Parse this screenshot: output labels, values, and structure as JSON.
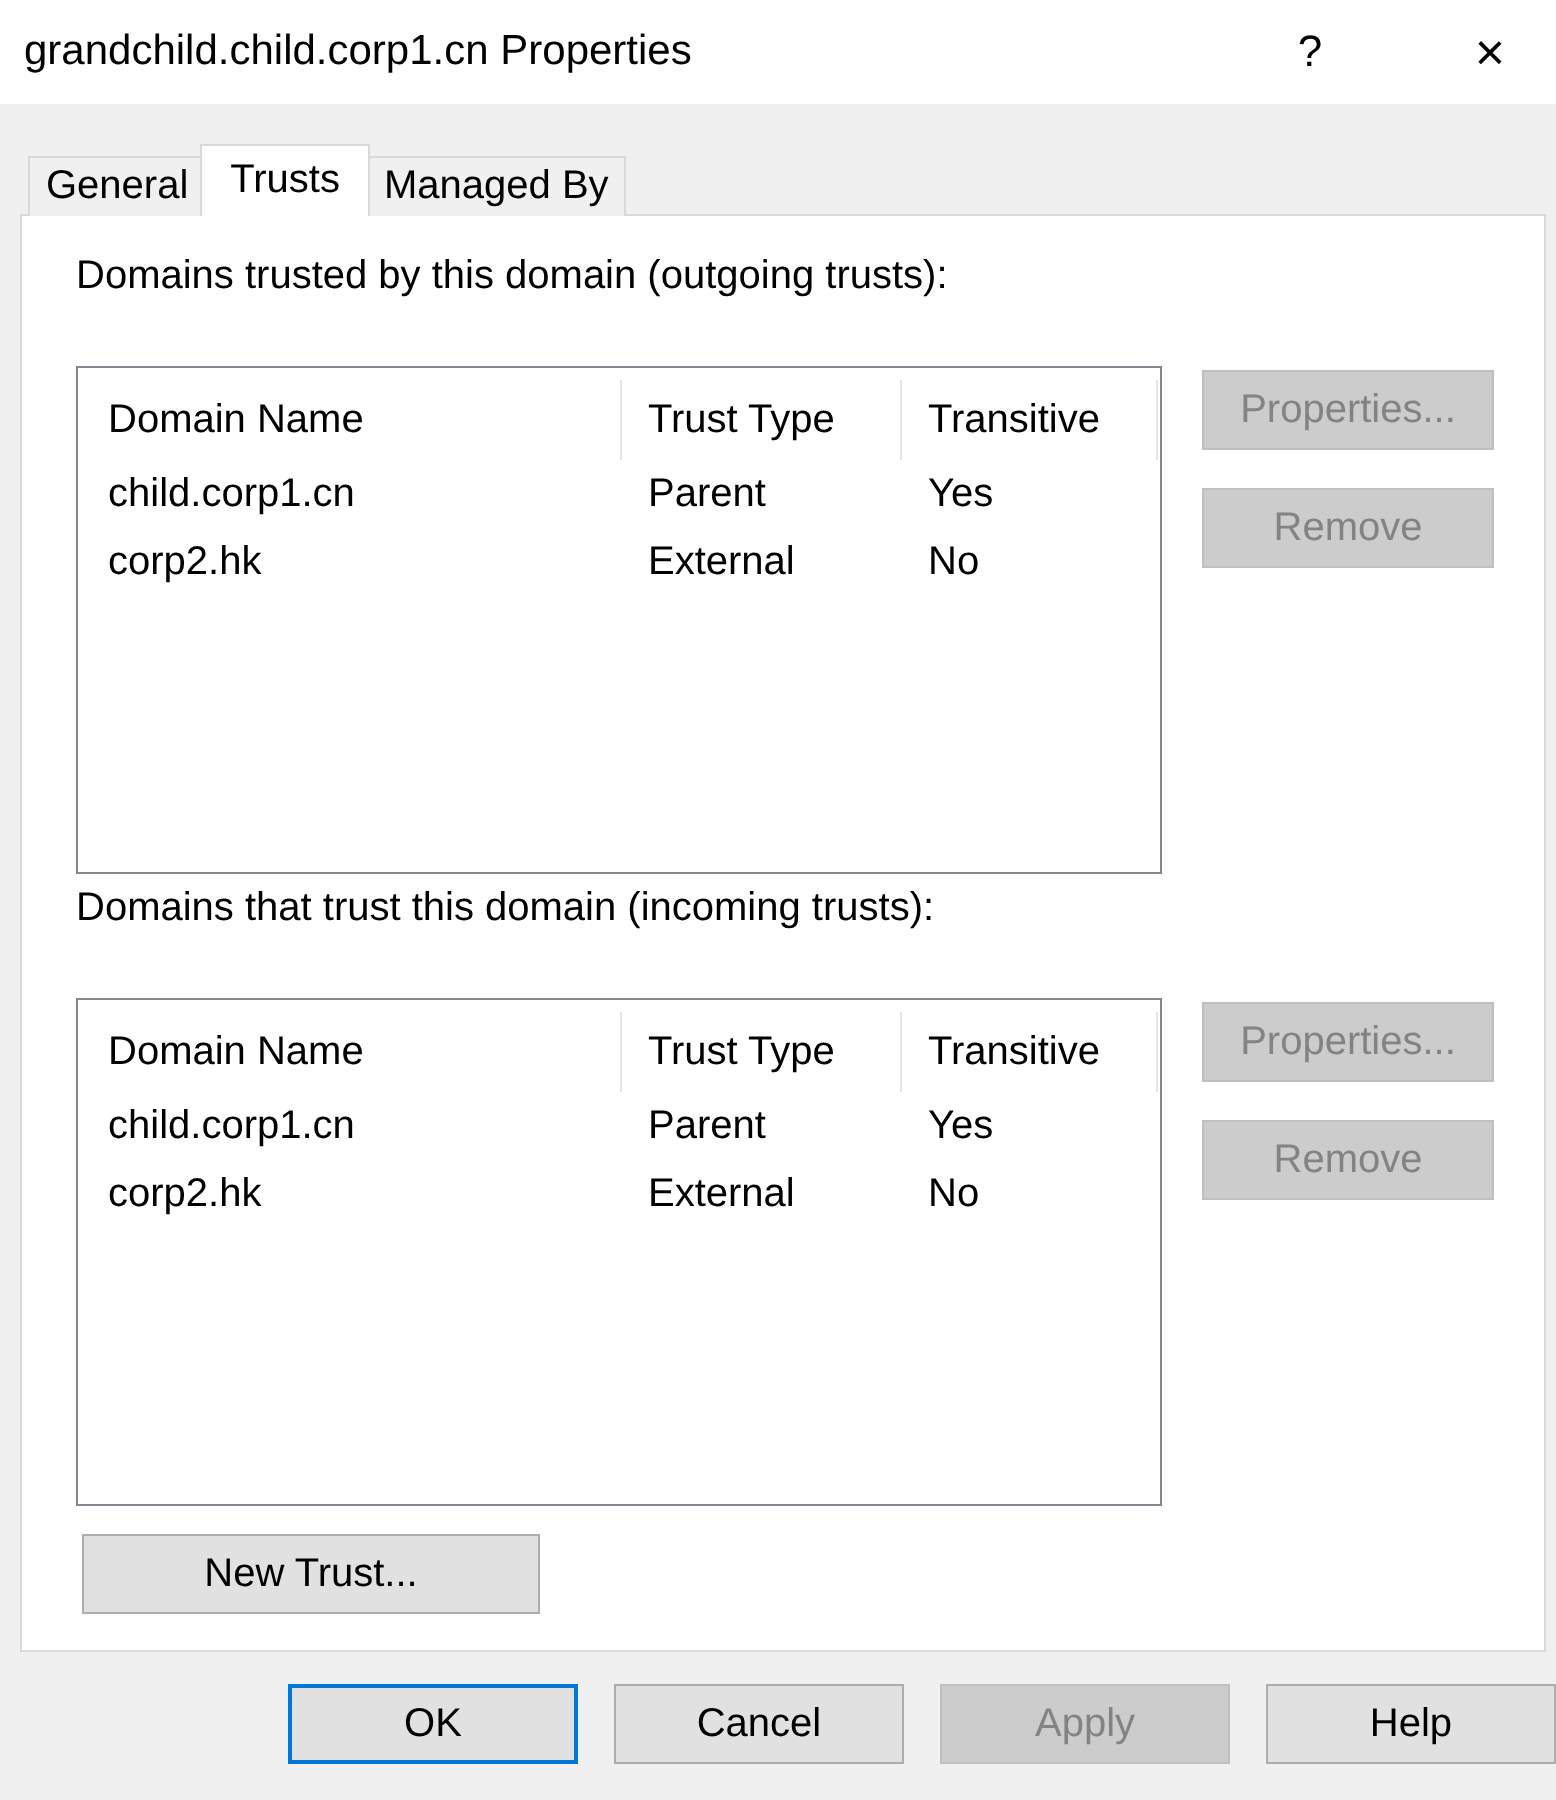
{
  "window": {
    "title": "grandchild.child.corp1.cn Properties",
    "help_button": "?",
    "close_button": "×"
  },
  "tabs": [
    {
      "label": "General",
      "selected": false
    },
    {
      "label": "Trusts",
      "selected": true
    },
    {
      "label": "Managed By",
      "selected": false
    }
  ],
  "sections": [
    {
      "label": "Domains trusted by this domain (outgoing trusts):",
      "columns": [
        "Domain Name",
        "Trust Type",
        "Transitive"
      ],
      "rows": [
        [
          "child.corp1.cn",
          "Parent",
          "Yes"
        ],
        [
          "corp2.hk",
          "External",
          "No"
        ]
      ],
      "buttons": [
        {
          "label": "Properties...",
          "disabled": true
        },
        {
          "label": "Remove",
          "disabled": true
        }
      ]
    },
    {
      "label": "Domains that trust this domain (incoming trusts):",
      "columns": [
        "Domain Name",
        "Trust Type",
        "Transitive"
      ],
      "rows": [
        [
          "child.corp1.cn",
          "Parent",
          "Yes"
        ],
        [
          "corp2.hk",
          "External",
          "No"
        ]
      ],
      "buttons": [
        {
          "label": "Properties...",
          "disabled": true
        },
        {
          "label": "Remove",
          "disabled": true
        }
      ]
    }
  ],
  "new_trust_button": {
    "label": "New Trust...",
    "disabled": false
  },
  "footer_buttons": [
    {
      "label": "OK",
      "disabled": false,
      "default": true
    },
    {
      "label": "Cancel",
      "disabled": false,
      "default": false
    },
    {
      "label": "Apply",
      "disabled": true,
      "default": false
    },
    {
      "label": "Help",
      "disabled": false,
      "default": false
    }
  ]
}
